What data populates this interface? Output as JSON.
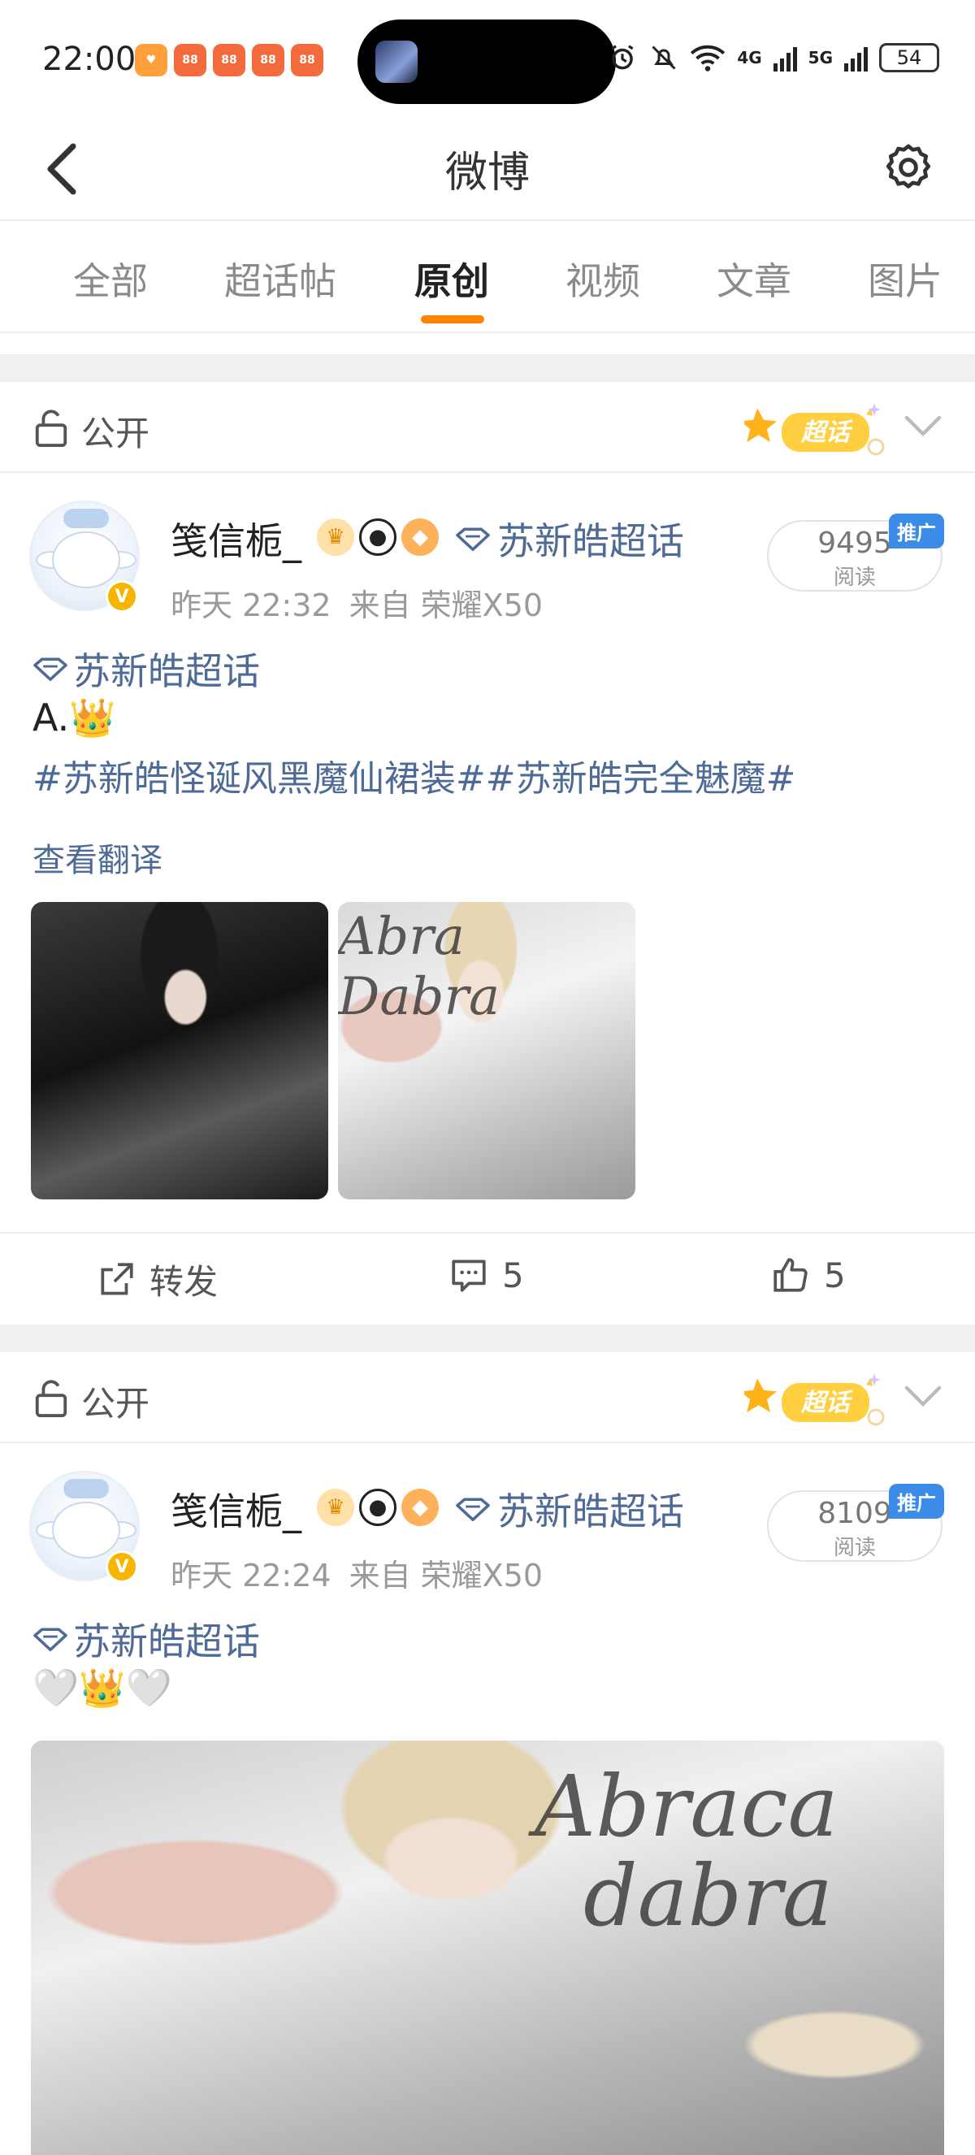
{
  "status_bar": {
    "time": "22:00",
    "network_4g": "4G",
    "network_5g": "5G",
    "battery": "54"
  },
  "header": {
    "title": "微博"
  },
  "tabs": [
    {
      "label": "全部"
    },
    {
      "label": "超话帖"
    },
    {
      "label": "原创"
    },
    {
      "label": "视频"
    },
    {
      "label": "文章"
    },
    {
      "label": "图片"
    }
  ],
  "active_tab": "原创",
  "accent_color": "#ff8200",
  "link_color": "#4e6b97",
  "posts": [
    {
      "visibility": "公开",
      "super_topic_badge": "超话",
      "user_name": "笺信栀_",
      "topic_link": "苏新皓超话",
      "time": "昨天 22:32",
      "source": "来自 荣耀X50",
      "read_count": "9495",
      "read_label": "阅读",
      "promo_tag": "推广",
      "body_topic": "苏新皓超话",
      "body_line": "A.👑",
      "hashtags": "#苏新皓怪诞风黑魔仙裙装##苏新皓完全魅魔#",
      "translate": "查看翻译",
      "photo_text": "Abra Dabra",
      "actions": {
        "repost": "转发",
        "comments": "5",
        "likes": "5"
      }
    },
    {
      "visibility": "公开",
      "super_topic_badge": "超话",
      "user_name": "笺信栀_",
      "topic_link": "苏新皓超话",
      "time": "昨天 22:24",
      "source": "来自 荣耀X50",
      "read_count": "8109",
      "read_label": "阅读",
      "promo_tag": "推广",
      "body_topic": "苏新皓超话",
      "body_line": "🤍👑🤍",
      "photo_text_1": "Abraca",
      "photo_text_2": "dabra"
    }
  ]
}
